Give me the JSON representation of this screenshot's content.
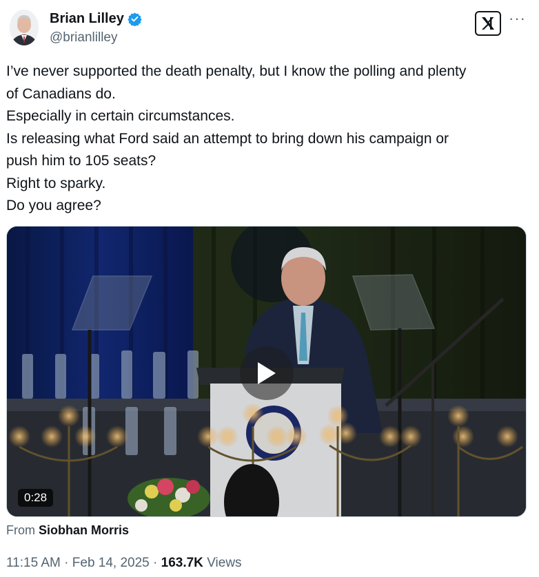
{
  "author": {
    "name": "Brian Lilley",
    "handle": "@brianlilley",
    "verified": true
  },
  "tweet": {
    "lines": [
      "I’ve never supported the death penalty, but I know the polling and plenty",
      "of Canadians do.",
      "Especially in certain circumstances.",
      "Is releasing what Ford said an attempt to bring down his campaign or",
      "push him to 105 seats?",
      "Right to sparky.",
      "Do you agree?"
    ]
  },
  "media": {
    "duration": "0:28",
    "from_prefix": "From",
    "from_source": "Siobhan Morris"
  },
  "meta": {
    "time": "11:15 AM",
    "date": "Feb 14, 2025",
    "separator": "·",
    "views_count": "163.7K",
    "views_label": "Views"
  },
  "icons": {
    "verified": "verified-badge-icon",
    "x_logo": "x-logo-icon",
    "more": "more-icon",
    "play": "play-icon"
  },
  "colors": {
    "text": "#0f1419",
    "secondary": "#536471",
    "verified": "#1d9bf0"
  }
}
